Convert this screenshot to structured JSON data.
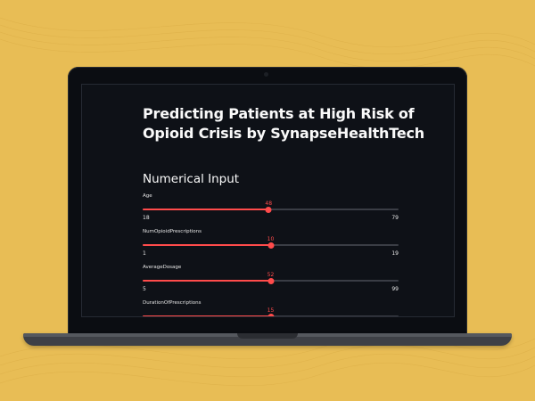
{
  "app": {
    "title": "Predicting Patients at High Risk of Opioid Crisis by SynapseHealthTech",
    "section_title": "Numerical Input"
  },
  "colors": {
    "background": "#e8bd55",
    "screen": "#0e1117",
    "accent": "#ff4b4b"
  },
  "sliders": [
    {
      "label": "Age",
      "value": "48",
      "min": "18",
      "max": "79",
      "fraction": 0.492
    },
    {
      "label": "NumOpioidPrescriptions",
      "value": "10",
      "min": "1",
      "max": "19",
      "fraction": 0.5
    },
    {
      "label": "AverageDosage",
      "value": "52",
      "min": "5",
      "max": "99",
      "fraction": 0.5
    },
    {
      "label": "DurationOfPrescriptions",
      "value": "15",
      "min": "",
      "max": "",
      "fraction": 0.5
    }
  ]
}
